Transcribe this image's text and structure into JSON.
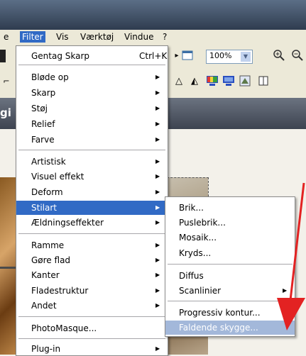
{
  "menubar": {
    "items": [
      {
        "label": "e"
      },
      {
        "label": "Filter"
      },
      {
        "label": "Vis"
      },
      {
        "label": "Værktøj"
      },
      {
        "label": "Vindue"
      },
      {
        "label": "?"
      }
    ]
  },
  "toolbar": {
    "zoom_value": "100%",
    "zoom_in_icon": "zoom-in-icon",
    "zoom_out_icon": "zoom-out-icon"
  },
  "left_glyph": "gi",
  "filter_menu": {
    "items": [
      {
        "label": "Gentag Skarp",
        "shortcut": "Ctrl+K"
      },
      {
        "label": "Bløde op"
      },
      {
        "label": "Skarp"
      },
      {
        "label": "Støj"
      },
      {
        "label": "Relief"
      },
      {
        "label": "Farve"
      },
      {
        "label": "Artistisk"
      },
      {
        "label": "Visuel effekt"
      },
      {
        "label": "Deform"
      },
      {
        "label": "Stilart"
      },
      {
        "label": "Ældningseffekter"
      },
      {
        "label": "Ramme"
      },
      {
        "label": "Gøre flad"
      },
      {
        "label": "Kanter"
      },
      {
        "label": "Fladestruktur"
      },
      {
        "label": "Andet"
      },
      {
        "label": "PhotoMasque..."
      },
      {
        "label": "Plug-in"
      }
    ]
  },
  "stilart_submenu": {
    "items": [
      {
        "label": "Brik..."
      },
      {
        "label": "Puslebrik..."
      },
      {
        "label": "Mosaik..."
      },
      {
        "label": "Kryds..."
      },
      {
        "label": "Diffus"
      },
      {
        "label": "Scanlinier"
      },
      {
        "label": "Progressiv kontur..."
      },
      {
        "label": "Faldende skygge..."
      }
    ]
  },
  "colors": {
    "highlight": "#316ac5",
    "disabled_highlight": "#a3b8da",
    "annotation_arrow": "#e32222"
  }
}
